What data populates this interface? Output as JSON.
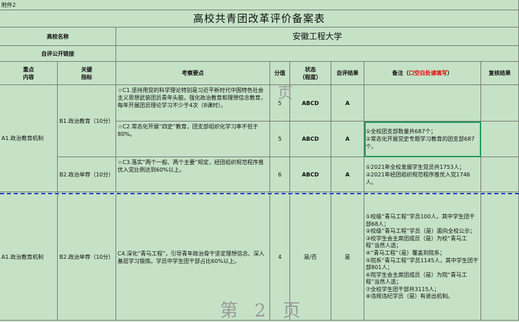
{
  "attachment": "附件2",
  "title": "高校共青团改革评价备案表",
  "school_label": "高校名称",
  "school_name": "安徽工程大学",
  "self_eval_link_label": "自评公开链接",
  "self_eval_link": "",
  "headers": {
    "key_content": "重点\n内容",
    "key_indicator": "关键\n指标",
    "points": "考察要点",
    "score": "分值",
    "status": "状态\n（程度）",
    "self_result": "自评结果",
    "remarks_prefix": "备注（",
    "remarks_red": "口空白处请填写",
    "remarks_suffix": "）",
    "review": "复核结果"
  },
  "rows": [
    {
      "key_content": "A1.政治教育机制",
      "indicator": "B1.政治教育（10分）",
      "points": "☆C1.坚持用党的科学理论特别是习近平新时代中国特色社会主义思想武装团员青年头脑，强化政治教育和理想信念教育，每年开展团员理论学习不少于4次（8课时）。",
      "score": "5",
      "status": "ABCD",
      "result": "A",
      "remark": ""
    },
    {
      "points": "☆C2.常态化开展“四史”教育，团支部组织化学习率不低于80%。",
      "score": "5",
      "status": "ABCD",
      "result": "A",
      "remark": "①全校团支部数量共687个；\n②常态化开展党史专题学习教育的团支部687个。"
    },
    {
      "indicator": "B2.政治举荐（10分）",
      "points": "☆C3.落实“两个一般、两个主要”规定，经团组织规范程序推优入党比例达到60%以上。",
      "score": "6",
      "status": "ABCD",
      "result": "A",
      "remark": "①2021年全校发展学生党员共1753人；\n②2021年经团组织规范程序推优入党1746人。"
    },
    {
      "key_content": "A1.政治教育机制",
      "indicator": "B2.政治举荐（10分）",
      "points": "C4.深化“青马工程”，引导青年政治骨干坚定理想信念、深入基层学习锻炼。学员中学生团干部占比60%以上。",
      "score": "4",
      "status": "是/否",
      "result": "是",
      "remark": "①校级“青马工程”学员100人，其中学生团干部68人；\n②校级“青马工程”学员（是）面向全校公示；\n③校学生会主席团成员（是）为校“青马工程”当然人选；\n④“青马工程”（是）覆盖到院系；\n⑤院系“青马工程”学员1145人，其中学生团干部801人；\n⑥院学生会主席团成员（是）为院“青马工程”当然人选；\n⑦全校学生团干部共3115人；\n⑧违规违纪学员（是）有退出机制。"
    }
  ],
  "page_marks": [
    "页",
    "第 2 页"
  ]
}
